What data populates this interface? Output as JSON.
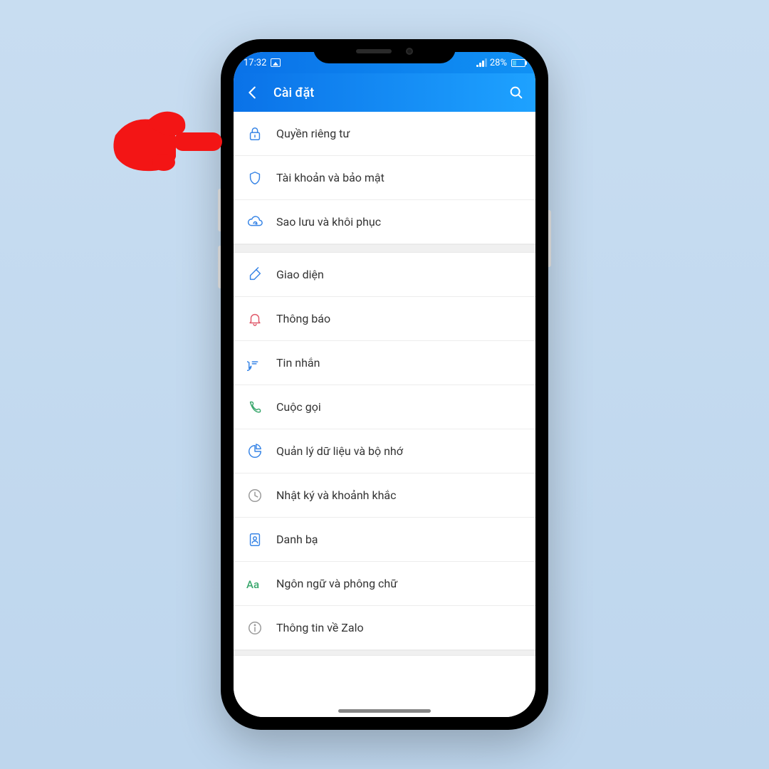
{
  "statusbar": {
    "time": "17:32",
    "battery_text": "28%"
  },
  "header": {
    "title": "Cài đặt"
  },
  "group1": [
    {
      "label": "Quyền riêng tư"
    },
    {
      "label": "Tài khoản và bảo mật"
    },
    {
      "label": "Sao lưu và khôi phục"
    }
  ],
  "group2": [
    {
      "label": "Giao diện"
    },
    {
      "label": "Thông báo"
    },
    {
      "label": "Tin nhắn"
    },
    {
      "label": "Cuộc gọi"
    },
    {
      "label": "Quản lý dữ liệu và bộ nhớ"
    },
    {
      "label": "Nhật ký và khoảnh khắc"
    },
    {
      "label": "Danh bạ"
    },
    {
      "label": "Ngôn ngữ và phông chữ"
    },
    {
      "label": "Thông tin về Zalo"
    }
  ],
  "colors": {
    "blue": "#3885e6",
    "red": "#e05a6b",
    "green": "#3aa76d",
    "grey": "#888"
  }
}
